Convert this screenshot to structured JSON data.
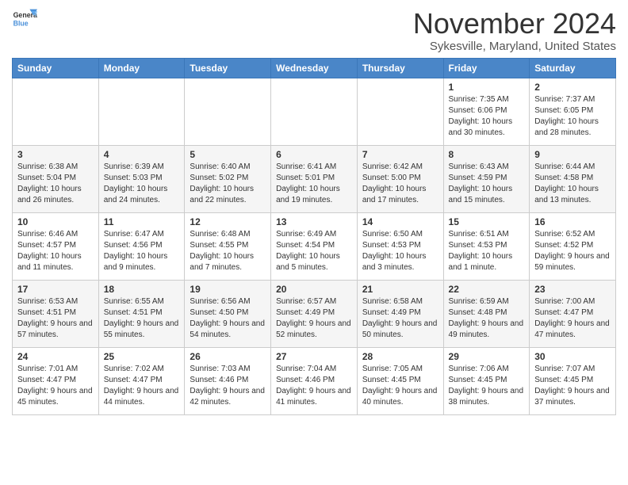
{
  "logo": {
    "general": "General",
    "blue": "Blue"
  },
  "header": {
    "month": "November 2024",
    "location": "Sykesville, Maryland, United States"
  },
  "weekdays": [
    "Sunday",
    "Monday",
    "Tuesday",
    "Wednesday",
    "Thursday",
    "Friday",
    "Saturday"
  ],
  "weeks": [
    [
      {
        "day": "",
        "info": ""
      },
      {
        "day": "",
        "info": ""
      },
      {
        "day": "",
        "info": ""
      },
      {
        "day": "",
        "info": ""
      },
      {
        "day": "",
        "info": ""
      },
      {
        "day": "1",
        "info": "Sunrise: 7:35 AM\nSunset: 6:06 PM\nDaylight: 10 hours and 30 minutes."
      },
      {
        "day": "2",
        "info": "Sunrise: 7:37 AM\nSunset: 6:05 PM\nDaylight: 10 hours and 28 minutes."
      }
    ],
    [
      {
        "day": "3",
        "info": "Sunrise: 6:38 AM\nSunset: 5:04 PM\nDaylight: 10 hours and 26 minutes."
      },
      {
        "day": "4",
        "info": "Sunrise: 6:39 AM\nSunset: 5:03 PM\nDaylight: 10 hours and 24 minutes."
      },
      {
        "day": "5",
        "info": "Sunrise: 6:40 AM\nSunset: 5:02 PM\nDaylight: 10 hours and 22 minutes."
      },
      {
        "day": "6",
        "info": "Sunrise: 6:41 AM\nSunset: 5:01 PM\nDaylight: 10 hours and 19 minutes."
      },
      {
        "day": "7",
        "info": "Sunrise: 6:42 AM\nSunset: 5:00 PM\nDaylight: 10 hours and 17 minutes."
      },
      {
        "day": "8",
        "info": "Sunrise: 6:43 AM\nSunset: 4:59 PM\nDaylight: 10 hours and 15 minutes."
      },
      {
        "day": "9",
        "info": "Sunrise: 6:44 AM\nSunset: 4:58 PM\nDaylight: 10 hours and 13 minutes."
      }
    ],
    [
      {
        "day": "10",
        "info": "Sunrise: 6:46 AM\nSunset: 4:57 PM\nDaylight: 10 hours and 11 minutes."
      },
      {
        "day": "11",
        "info": "Sunrise: 6:47 AM\nSunset: 4:56 PM\nDaylight: 10 hours and 9 minutes."
      },
      {
        "day": "12",
        "info": "Sunrise: 6:48 AM\nSunset: 4:55 PM\nDaylight: 10 hours and 7 minutes."
      },
      {
        "day": "13",
        "info": "Sunrise: 6:49 AM\nSunset: 4:54 PM\nDaylight: 10 hours and 5 minutes."
      },
      {
        "day": "14",
        "info": "Sunrise: 6:50 AM\nSunset: 4:53 PM\nDaylight: 10 hours and 3 minutes."
      },
      {
        "day": "15",
        "info": "Sunrise: 6:51 AM\nSunset: 4:53 PM\nDaylight: 10 hours and 1 minute."
      },
      {
        "day": "16",
        "info": "Sunrise: 6:52 AM\nSunset: 4:52 PM\nDaylight: 9 hours and 59 minutes."
      }
    ],
    [
      {
        "day": "17",
        "info": "Sunrise: 6:53 AM\nSunset: 4:51 PM\nDaylight: 9 hours and 57 minutes."
      },
      {
        "day": "18",
        "info": "Sunrise: 6:55 AM\nSunset: 4:51 PM\nDaylight: 9 hours and 55 minutes."
      },
      {
        "day": "19",
        "info": "Sunrise: 6:56 AM\nSunset: 4:50 PM\nDaylight: 9 hours and 54 minutes."
      },
      {
        "day": "20",
        "info": "Sunrise: 6:57 AM\nSunset: 4:49 PM\nDaylight: 9 hours and 52 minutes."
      },
      {
        "day": "21",
        "info": "Sunrise: 6:58 AM\nSunset: 4:49 PM\nDaylight: 9 hours and 50 minutes."
      },
      {
        "day": "22",
        "info": "Sunrise: 6:59 AM\nSunset: 4:48 PM\nDaylight: 9 hours and 49 minutes."
      },
      {
        "day": "23",
        "info": "Sunrise: 7:00 AM\nSunset: 4:47 PM\nDaylight: 9 hours and 47 minutes."
      }
    ],
    [
      {
        "day": "24",
        "info": "Sunrise: 7:01 AM\nSunset: 4:47 PM\nDaylight: 9 hours and 45 minutes."
      },
      {
        "day": "25",
        "info": "Sunrise: 7:02 AM\nSunset: 4:47 PM\nDaylight: 9 hours and 44 minutes."
      },
      {
        "day": "26",
        "info": "Sunrise: 7:03 AM\nSunset: 4:46 PM\nDaylight: 9 hours and 42 minutes."
      },
      {
        "day": "27",
        "info": "Sunrise: 7:04 AM\nSunset: 4:46 PM\nDaylight: 9 hours and 41 minutes."
      },
      {
        "day": "28",
        "info": "Sunrise: 7:05 AM\nSunset: 4:45 PM\nDaylight: 9 hours and 40 minutes."
      },
      {
        "day": "29",
        "info": "Sunrise: 7:06 AM\nSunset: 4:45 PM\nDaylight: 9 hours and 38 minutes."
      },
      {
        "day": "30",
        "info": "Sunrise: 7:07 AM\nSunset: 4:45 PM\nDaylight: 9 hours and 37 minutes."
      }
    ]
  ]
}
